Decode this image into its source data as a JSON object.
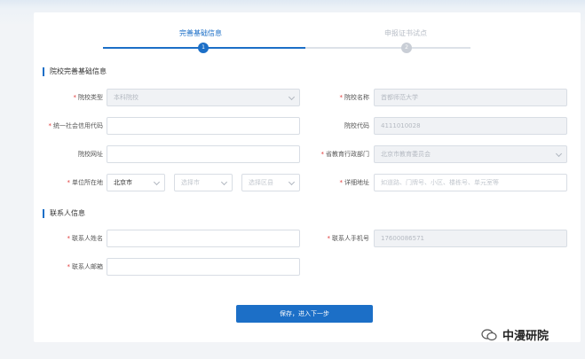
{
  "stepper": {
    "step1_label": "完善基础信息",
    "step1_number": "1",
    "step2_label": "申报证书试点",
    "step2_number": "2"
  },
  "section_school": {
    "title": "院校完善基础信息"
  },
  "fields": {
    "school_type": {
      "label": "院校类型",
      "value": "本科院校"
    },
    "school_name": {
      "label": "院校名称",
      "value": "首都师范大学"
    },
    "credit_code": {
      "label": "统一社会信用代码",
      "value": ""
    },
    "school_code": {
      "label": "院校代码",
      "value": "4111010028"
    },
    "website": {
      "label": "院校网址",
      "value": ""
    },
    "education_dept": {
      "label": "省教育行政部门",
      "value": "北京市教育委员会"
    },
    "location": {
      "label": "单位所在地",
      "city": "北京市",
      "district_placeholder": "选择市",
      "area_placeholder": "选择区县"
    },
    "address": {
      "label": "详细地址",
      "placeholder": "如道路、门牌号、小区、楼栋号、单元室等"
    }
  },
  "section_contact": {
    "title": "联系人信息"
  },
  "contact": {
    "name": {
      "label": "联系人姓名",
      "value": ""
    },
    "phone": {
      "label": "联系人手机号",
      "value": "17600086571"
    },
    "email": {
      "label": "联系人邮箱",
      "value": ""
    }
  },
  "submit_label": "保存，进入下一步",
  "watermark": {
    "text": "中漫研院"
  },
  "colors": {
    "accent": "#1c6fc7",
    "required": "#e03a3a"
  }
}
